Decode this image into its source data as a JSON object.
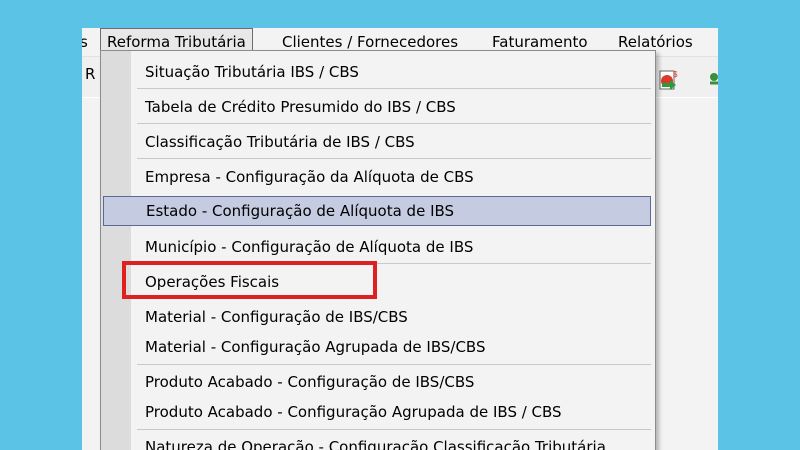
{
  "menubar": {
    "items": [
      {
        "label": "s",
        "active": false
      },
      {
        "label": "Reforma Tributária",
        "active": true
      },
      {
        "label": "Clientes / Fornecedores",
        "active": false
      },
      {
        "label": "Faturamento",
        "active": false
      },
      {
        "label": "Relatórios",
        "active": false
      }
    ]
  },
  "toolbar": {
    "left_label": "R"
  },
  "dropdown": {
    "items": [
      {
        "label": "Situação Tributária IBS / CBS"
      },
      {
        "label": "Tabela de Crédito Presumido do IBS / CBS"
      },
      {
        "label": "Classificação Tributária de IBS / CBS"
      },
      {
        "label": "Empresa - Configuração da Alíquota de CBS"
      },
      {
        "label": "Estado  - Configuração de Alíquota de IBS",
        "highlighted": true
      },
      {
        "label": "Município - Configuração de Alíquota de IBS"
      },
      {
        "label": "Operações Fiscais",
        "annotated": true
      },
      {
        "label": "Material - Configuração de IBS/CBS"
      },
      {
        "label": "Material - Configuração Agrupada de IBS/CBS"
      },
      {
        "label": "Produto Acabado - Configuração de IBS/CBS"
      },
      {
        "label": "Produto Acabado - Configuração Agrupada de IBS / CBS"
      },
      {
        "label": "Natureza de Operação - Configuração Classificação Tributária"
      }
    ]
  },
  "colors": {
    "background_frame": "#5bc4e6",
    "highlight": "#c5cbe0",
    "annotation": "#e02020"
  },
  "icons": [
    "report-dollar-icon",
    "green-arrow-icon"
  ]
}
